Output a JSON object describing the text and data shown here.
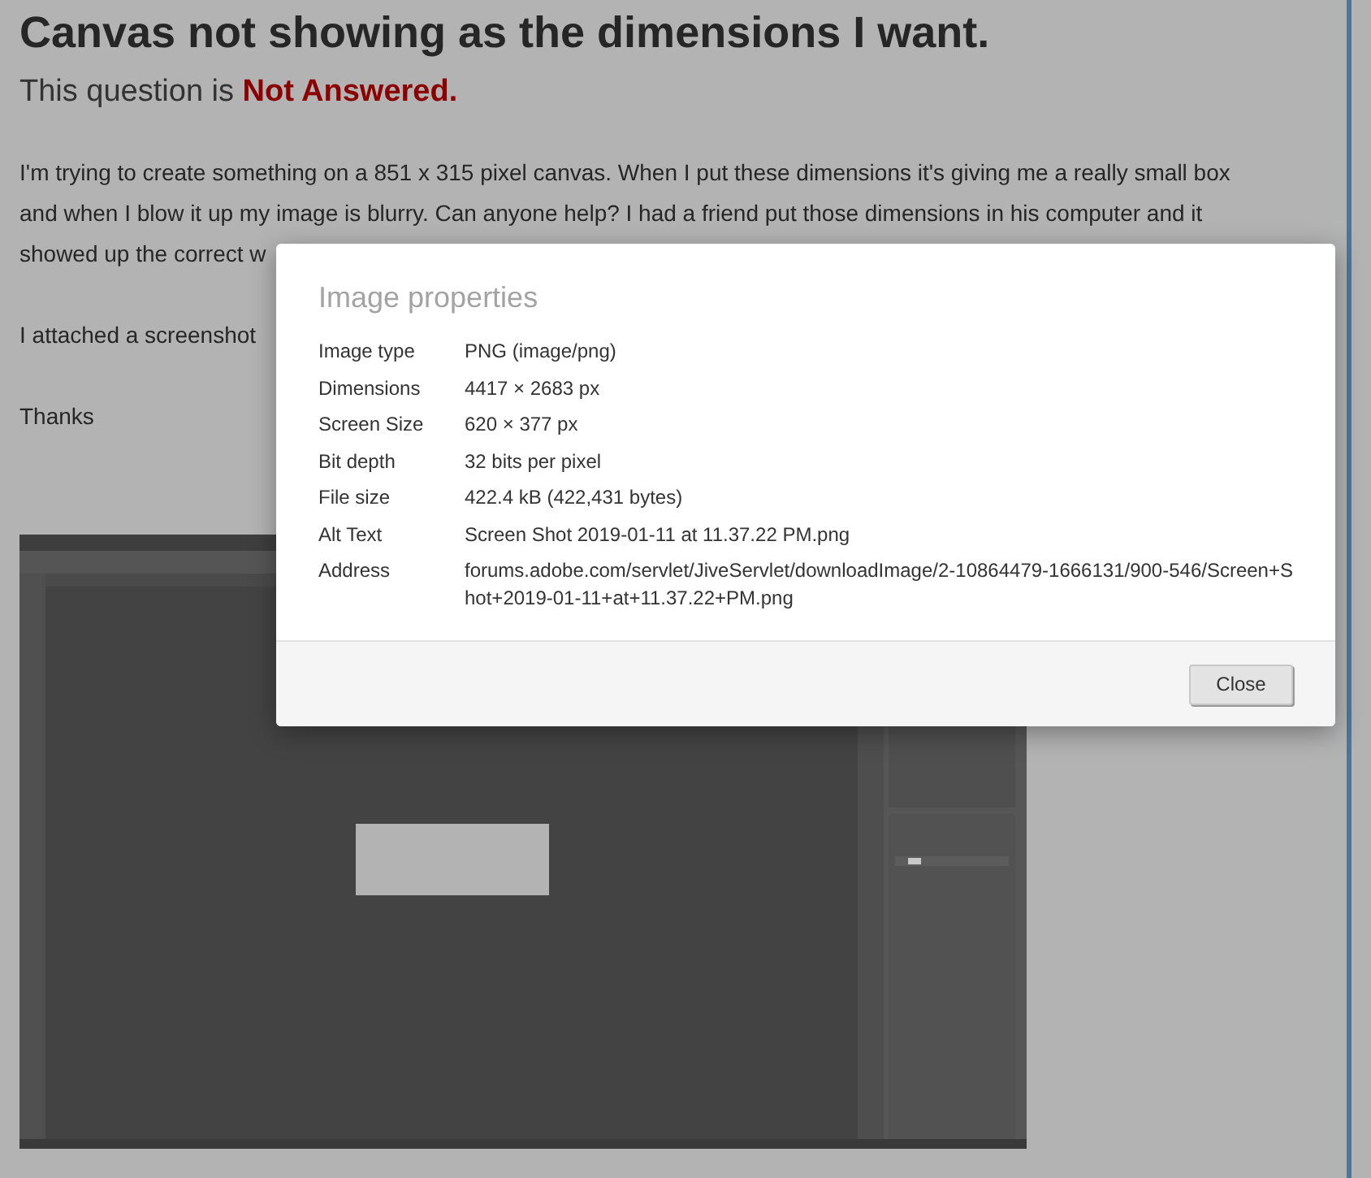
{
  "post": {
    "title": "Canvas not showing as the dimensions I want.",
    "status_prefix": "This question is ",
    "status": "Not Answered.",
    "paragraph_lines": [
      "I'm trying to create something on a 851 x 315 pixel canvas. When I put these dimensions it's giving me a really small box",
      "and when I blow it up my image is blurry. Can anyone help? I had a friend put those dimensions in his computer and it",
      "showed up the correct w"
    ],
    "attachment_line": "I attached a screenshot",
    "signoff": "Thanks"
  },
  "dialog": {
    "title": "Image properties",
    "rows": [
      {
        "label": "Image type",
        "value": "PNG (image/png)"
      },
      {
        "label": "Dimensions",
        "value": "4417 × 2683 px"
      },
      {
        "label": "Screen Size",
        "value": "620 × 377 px"
      },
      {
        "label": "Bit depth",
        "value": "32 bits per pixel"
      },
      {
        "label": "File size",
        "value": "422.4 kB (422,431 bytes)"
      },
      {
        "label": "Alt Text",
        "value": "Screen Shot 2019-01-11 at 11.37.22 PM.png"
      },
      {
        "label": "Address",
        "value": "forums.adobe.com/servlet/JiveServlet/downloadImage/2-10864479-1666131/900-546/Screen+Shot+2019-01-11+at+11.37.22+PM.png"
      }
    ],
    "button": "Close"
  }
}
